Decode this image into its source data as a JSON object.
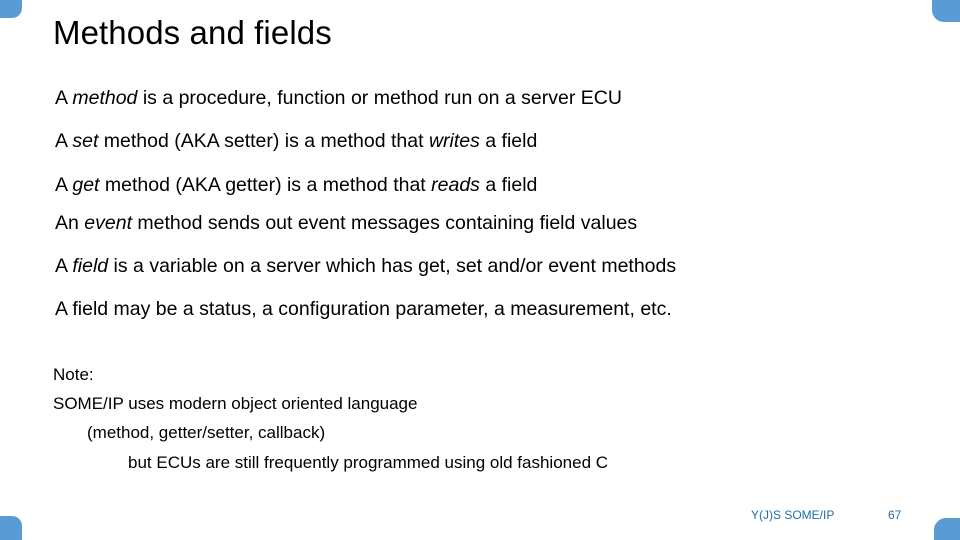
{
  "slide": {
    "title": "Methods and fields",
    "accent_color": "#5B9BD5",
    "footer_color": "#1F6FA8",
    "text_color": "#000000",
    "background_color": "#FFFFFF"
  },
  "body": {
    "paragraphs": [
      {
        "id": "p1",
        "segments": [
          {
            "text": "A ",
            "italic": false
          },
          {
            "text": "method",
            "italic": true
          },
          {
            "text": " is a procedure, function or method run on a server ECU",
            "italic": false
          }
        ],
        "plain": "A method is a procedure, function or method run on a server ECU"
      },
      {
        "id": "p2",
        "segments": [
          {
            "text": "A ",
            "italic": false
          },
          {
            "text": "set",
            "italic": true
          },
          {
            "text": " method (AKA setter) is a method that ",
            "italic": false
          },
          {
            "text": "writes",
            "italic": true
          },
          {
            "text": " a field",
            "italic": false
          }
        ],
        "plain": "A set method (AKA setter) is a method that writes a field"
      },
      {
        "id": "p3",
        "segments": [
          {
            "text": "A ",
            "italic": false
          },
          {
            "text": "get",
            "italic": true
          },
          {
            "text": " method (AKA getter) is a method that ",
            "italic": false
          },
          {
            "text": "reads",
            "italic": true
          },
          {
            "text": " a field",
            "italic": false
          }
        ],
        "plain": "A get method (AKA getter) is a method that reads a field"
      },
      {
        "id": "p4",
        "segments": [
          {
            "text": "An ",
            "italic": false
          },
          {
            "text": "event",
            "italic": true
          },
          {
            "text": " method sends out event messages containing field values",
            "italic": false
          }
        ],
        "plain": "An event method sends out event messages containing field values"
      },
      {
        "id": "p5",
        "segments": [
          {
            "text": "A ",
            "italic": false
          },
          {
            "text": "field",
            "italic": true
          },
          {
            "text": " is a variable on a server which has get, set and/or event methods",
            "italic": false
          }
        ],
        "plain": "A field is a variable on a server which has get, set and/or event methods"
      },
      {
        "id": "p6",
        "segments": [
          {
            "text": "A field may be a status, a configuration parameter, a measurement, etc.",
            "italic": false
          }
        ],
        "plain": "A field may be a status, a configuration parameter, a measurement, etc."
      }
    ]
  },
  "note": {
    "lines": [
      {
        "id": "n1",
        "text": "Note:",
        "indent": 0
      },
      {
        "id": "n2",
        "text": "SOME/IP uses modern object oriented language",
        "indent": 0
      },
      {
        "id": "n3",
        "text": "(method, getter/setter, callback)",
        "indent": 1
      },
      {
        "id": "n4",
        "text": "but ECUs are still frequently programmed using old fashioned C",
        "indent": 2
      }
    ]
  },
  "footer": {
    "label": "Y(J)S  SOME/IP",
    "page_number": "67"
  }
}
